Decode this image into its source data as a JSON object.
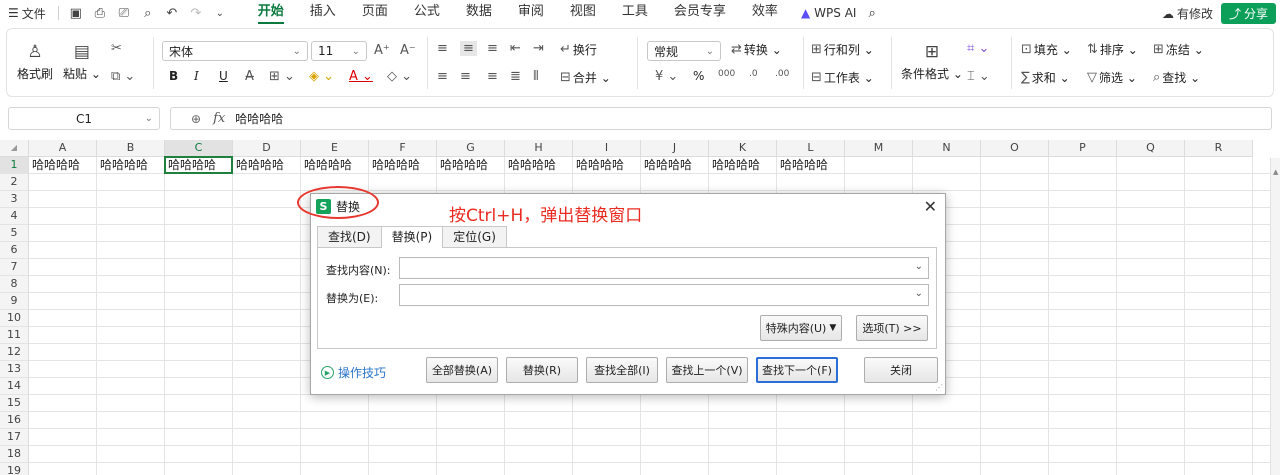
{
  "menubar": {
    "file": "文件",
    "tabs": [
      "开始",
      "插入",
      "页面",
      "公式",
      "数据",
      "审阅",
      "视图",
      "工具",
      "会员专享",
      "效率"
    ],
    "active_tab": "开始",
    "wps_ai": "WPS AI",
    "modify": "有修改",
    "share": "分享"
  },
  "ribbon": {
    "format_painter": "格式刷",
    "paste": "粘贴",
    "font_name": "宋体",
    "font_size": "11",
    "bold": "B",
    "italic": "I",
    "underline": "U",
    "wrap": "换行",
    "merge": "合并",
    "number_format": "常规",
    "convert": "转换",
    "rows_cols": "行和列",
    "worksheet": "工作表",
    "conditional_format": "条件格式",
    "fill": "填充",
    "sort": "排序",
    "freeze": "冻结",
    "sum": "求和",
    "filter": "筛选",
    "find": "查找",
    "percent": "%"
  },
  "formula_bar": {
    "name_box": "C1",
    "fx": "fx",
    "value": "哈哈哈哈"
  },
  "grid": {
    "columns": [
      "A",
      "B",
      "C",
      "D",
      "E",
      "F",
      "G",
      "H",
      "I",
      "J",
      "K",
      "L",
      "M",
      "N",
      "O",
      "P",
      "Q",
      "R"
    ],
    "rows": [
      "1",
      "2",
      "3",
      "4",
      "5",
      "6",
      "7",
      "8",
      "9",
      "10",
      "11",
      "12",
      "13",
      "14",
      "15",
      "16",
      "17",
      "18",
      "19"
    ],
    "row1": [
      "哈哈哈哈",
      "哈哈哈哈",
      "哈哈哈哈",
      "哈哈哈哈",
      "哈哈哈哈",
      "哈哈哈哈",
      "哈哈哈哈",
      "哈哈哈哈",
      "哈哈哈哈",
      "哈哈哈哈",
      "哈哈哈哈",
      "哈哈哈哈"
    ],
    "selected_cell": "C1"
  },
  "dialog": {
    "title": "替换",
    "tabs": [
      "查找(D)",
      "替换(P)",
      "定位(G)"
    ],
    "active_tab": "替换(P)",
    "find_label": "查找内容(N):",
    "find_value": "",
    "replace_label": "替换为(E):",
    "replace_value": "",
    "special_button": "特殊内容(U)",
    "options_button": "选项(T) >>",
    "tips_link": "操作技巧",
    "buttons": {
      "replace_all": "全部替换(A)",
      "replace": "替换(R)",
      "find_all": "查找全部(I)",
      "find_prev": "查找上一个(V)",
      "find_next": "查找下一个(F)",
      "close": "关闭"
    }
  },
  "annotation": {
    "text": "按Ctrl+H，弹出替换窗口",
    "color": "#ea2b22"
  },
  "colors": {
    "accent": "#0c7a3e",
    "share": "#0c9f5a",
    "active_cell_border": "#1f7f3c",
    "primary_button_border": "#2a6fd6"
  }
}
